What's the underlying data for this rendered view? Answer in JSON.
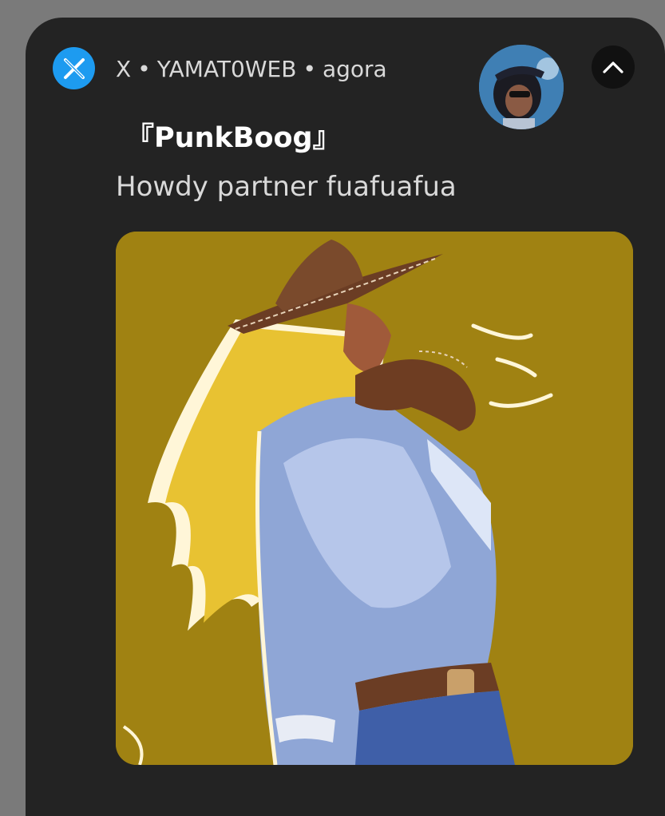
{
  "notification": {
    "app_icon": "x-logo-icon",
    "app_name": "X",
    "separator": "•",
    "account": "YAMAT0WEB",
    "time": "agora",
    "title": "『PunkBoog』",
    "message": "Howdy partner fuafuafua",
    "collapse_icon": "chevron-up-icon",
    "image_icon": "cowboy-illustration",
    "colors": {
      "card_bg": "#232323",
      "app_icon_bg": "#1d9bf0",
      "image_bg": "#a08212",
      "text_primary": "#ffffff",
      "text_secondary": "#d9d9d9"
    }
  }
}
